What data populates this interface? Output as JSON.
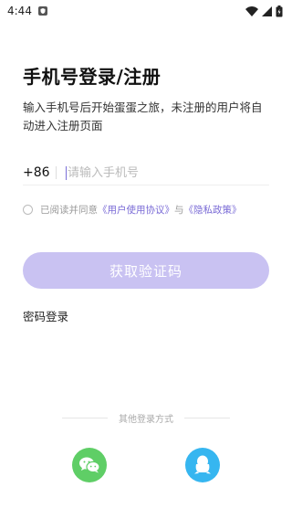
{
  "status": {
    "time": "4:44"
  },
  "login": {
    "title": "手机号登录/注册",
    "subtitle": "输入手机号后开始蛋蛋之旅，未注册的用户将自动进入注册页面",
    "country_code": "+86",
    "phone_placeholder": "请输入手机号",
    "agreement_prefix": "已阅读并同意",
    "user_agreement": "《用户使用协议》",
    "agreement_and": "与",
    "privacy_policy": "《隐私政策》",
    "get_code_label": "获取验证码",
    "password_login_label": "密码登录",
    "other_methods_label": "其他登录方式"
  },
  "colors": {
    "accent": "#7a6bd6",
    "button_bg": "#c9c2f2",
    "wechat": "#5fce66",
    "qq": "#36b6f0"
  },
  "icons": {
    "social": [
      "wechat-icon",
      "qq-icon"
    ]
  }
}
